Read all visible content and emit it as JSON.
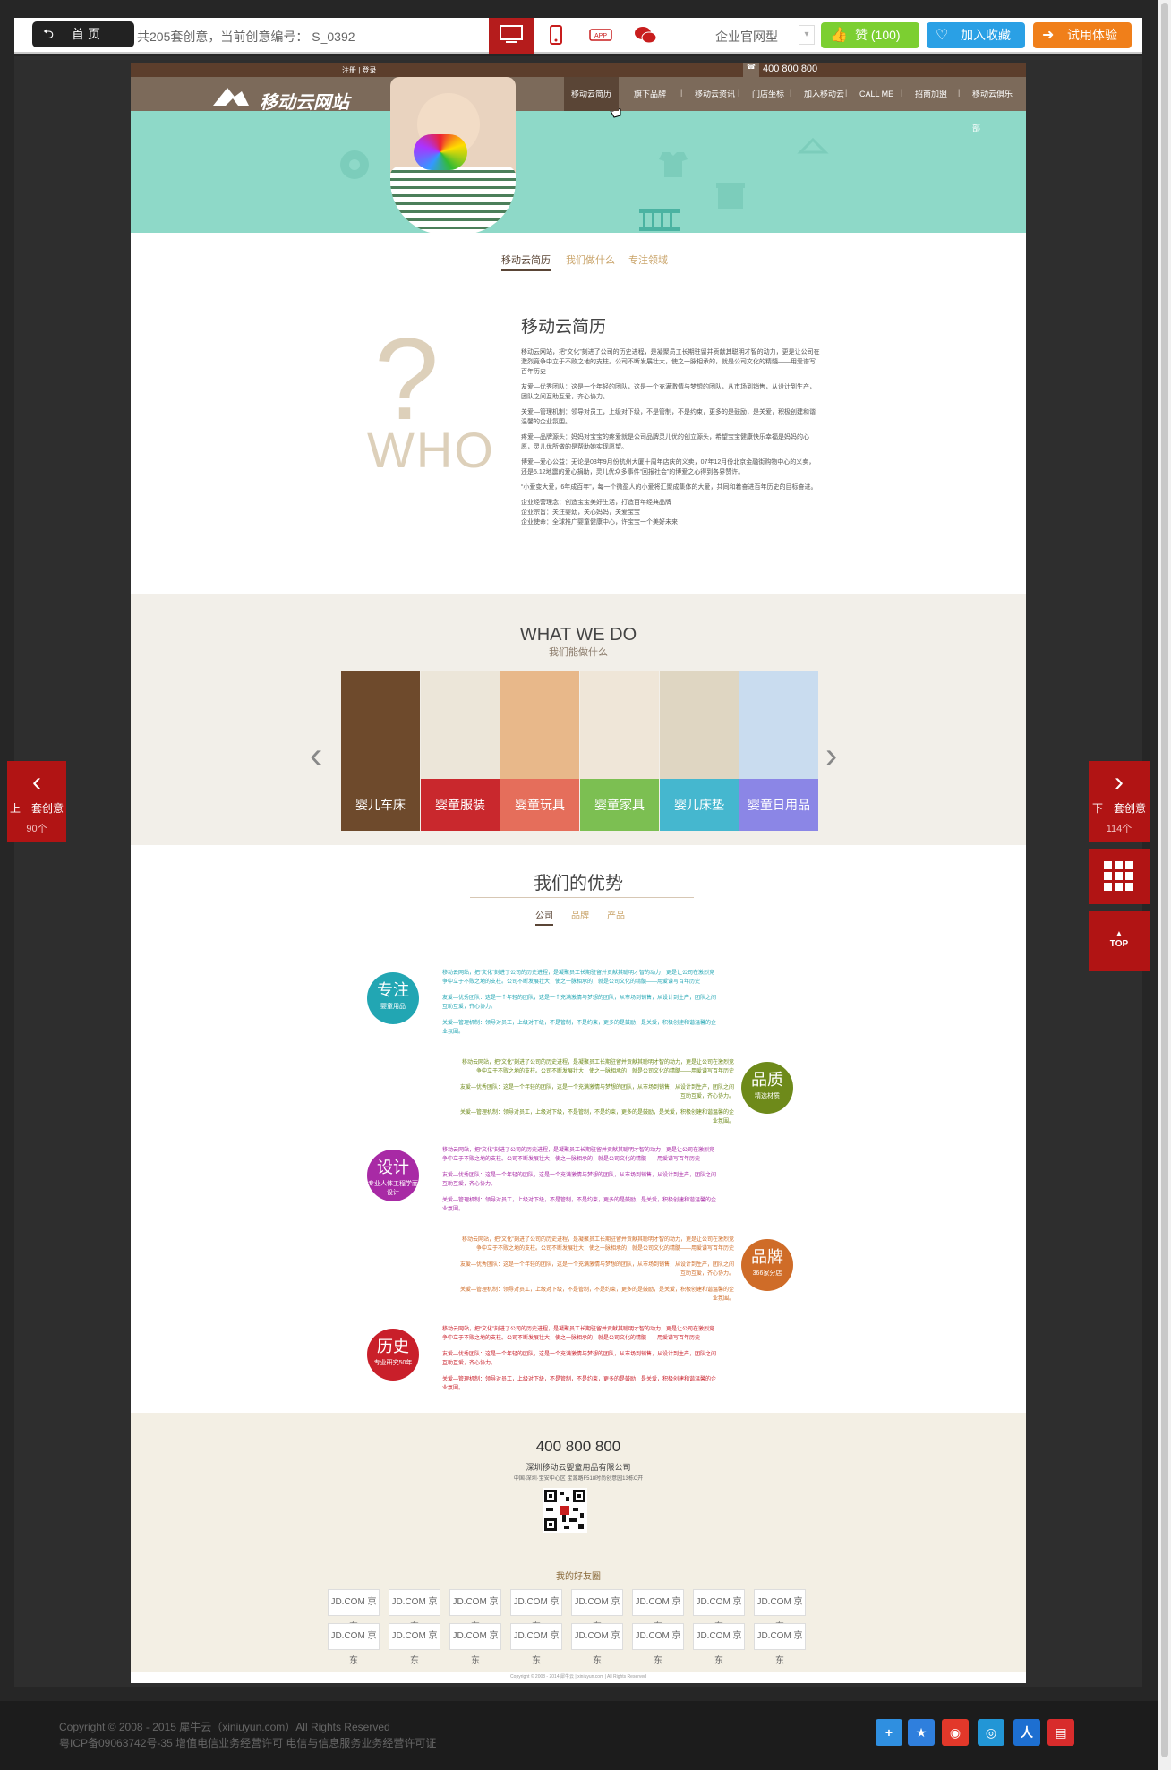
{
  "topbar": {
    "home_label": "首页",
    "count_text": "共205套创意，当前创意编号： S_0392",
    "devices": [
      "desktop-icon",
      "mobile-icon",
      "app-icon",
      "wechat-icon"
    ],
    "site_type": "企业官网型",
    "like_label": "赞 (100)",
    "fav_label": "加入收藏",
    "trial_label": "试用体验",
    "colors": {
      "like": "#7ccf31",
      "fav": "#2aa0e5",
      "trial": "#f07f1a",
      "active": "#b51c1c"
    }
  },
  "site": {
    "strip_left": "注册 | 登录",
    "phone": "400 800 800",
    "logo_text": "移动云网站",
    "nav": [
      "移动云简历",
      "旗下品牌",
      "移动云资讯",
      "门店坐标",
      "加入移动云",
      "CALL ME",
      "招商加盟",
      "移动云俱乐部"
    ],
    "subtabs": [
      "移动云简历",
      "我们做什么",
      "专注领域"
    ],
    "who": {
      "title": "移动云简历",
      "q": "?",
      "word": "WHO",
      "paras": [
        "移动云网站，把“文化”刻进了公司的历史进程，是凝聚员工长期驻留并贡献其聪明才智的动力，更是让公司在激烈竞争中立于不败之地的支柱。公司不断发展壮大，使之一脉相承的，就是公司文化的精髓——用爱谱写百年历史",
        "友爱—优秀团队：这是一个年轻的团队，这是一个充满激情与梦想的团队，从市场到销售，从设计到生产，团队之间互助互爱，齐心协力。",
        "关爱—管理机制：领导对员工，上级对下级，不是管制，不是约束，更多的是鼓励，是关爱，积极创建和谐温馨的企业氛围。",
        "疼爱—品牌源头：妈妈对宝宝的疼爱就是公司品牌灵儿优的创立源头，希望宝宝健康快乐幸福是妈妈的心愿，灵儿优所做的是帮助她实现愿望。",
        "博爱—爱心公益：无论是03年9月份杭州大厦十周年店庆的义卖，07年12月份北京金融街购物中心的义卖，还是5.12地震的爱心捐助，灵儿优众多事件“回报社会”的博爱之心得到各界赞许。",
        "“小爱变大爱，6年成百年”，每一个微盈人的小爱将汇聚成集体的大爱，共同和着奋进百年历史的目标奋进。",
        "企业经营理念：创造宝宝美好生活，打造百年经典品牌\n企业宗旨：关注婴幼，关心妈妈，关爱宝宝\n企业使命：全球推广婴童健康中心，许宝宝一个美好未来"
      ]
    },
    "what": {
      "title": "WHAT WE DO",
      "subtitle": "我们能做什么",
      "cats": [
        {
          "label": "婴儿车床",
          "color": "#5c3b23",
          "img": "#6e4a2c"
        },
        {
          "label": "婴童服装",
          "color": "#c9282d",
          "img": "#ece6d9"
        },
        {
          "label": "婴童玩具",
          "color": "#e56e5b",
          "img": "#e8b88a"
        },
        {
          "label": "婴童家具",
          "color": "#7cbf52",
          "img": "#efe6d8"
        },
        {
          "label": "婴儿床垫",
          "color": "#45b7cf",
          "img": "#dfd6c2"
        },
        {
          "label": "婴童日用品",
          "color": "#8b86e6",
          "img": "#c9dcef"
        }
      ]
    },
    "advantage": {
      "title": "我们的优势",
      "tabs": [
        "公司",
        "品牌",
        "产品"
      ],
      "rows": [
        {
          "big": "专注",
          "small": "婴童用品",
          "color": "#22a6b3",
          "lines": [
            "移动云网站，把“文化”刻进了公司的历史进程，是凝聚员工长期驻留并贡献其聪明才智的动力，更是让公司在激烈竞争中立于不败之地的支柱。公司不断发展壮大，使之一脉相承的，就是公司文化的精髓——用爱谱写百年历史",
            "友爱—优秀团队：这是一个年轻的团队，这是一个充满激情与梦想的团队，从市场到销售，从设计到生产，团队之间互助互爱，齐心协力。",
            "关爱—管理机制：领导对员工，上级对下级，不是管制，不是约束，更多的是鼓励，是关爱，积极创建和谐温馨的企业氛围。"
          ]
        },
        {
          "big": "品质",
          "small": "精选材质",
          "color": "#6e8a1a",
          "lines": [
            "移动云网站，把“文化”刻进了公司的历史进程，是凝聚员工长期驻留并贡献其聪明才智的动力，更是让公司在激烈竞争中立于不败之地的支柱。公司不断发展壮大，使之一脉相承的，就是公司文化的精髓——用爱谱写百年历史",
            "友爱—优秀团队：这是一个年轻的团队，这是一个充满激情与梦想的团队，从市场到销售，从设计到生产，团队之间互助互爱，齐心协力。",
            "关爱—管理机制：领导对员工，上级对下级，不是管制，不是约束，更多的是鼓励，是关爱，积极创建和谐温馨的企业氛围。"
          ]
        },
        {
          "big": "设计",
          "small": "专业人体工程学而设计",
          "color": "#a82aa5",
          "lines": [
            "移动云网站，把“文化”刻进了公司的历史进程，是凝聚员工长期驻留并贡献其聪明才智的动力，更是让公司在激烈竞争中立于不败之地的支柱。公司不断发展壮大，使之一脉相承的，就是公司文化的精髓——用爱谱写百年历史",
            "友爱—优秀团队：这是一个年轻的团队，这是一个充满激情与梦想的团队，从市场到销售，从设计到生产，团队之间互助互爱，齐心协力。",
            "关爱—管理机制：领导对员工，上级对下级，不是管制，不是约束，更多的是鼓励，是关爱，积极创建和谐温馨的企业氛围。"
          ]
        },
        {
          "big": "品牌",
          "small": "366家分店",
          "color": "#cf6c28",
          "lines": [
            "移动云网站，把“文化”刻进了公司的历史进程，是凝聚员工长期驻留并贡献其聪明才智的动力，更是让公司在激烈竞争中立于不败之地的支柱。公司不断发展壮大，使之一脉相承的，就是公司文化的精髓——用爱谱写百年历史",
            "友爱—优秀团队：这是一个年轻的团队，这是一个充满激情与梦想的团队，从市场到销售，从设计到生产，团队之间互助互爱，齐心协力。",
            "关爱—管理机制：领导对员工，上级对下级，不是管制，不是约束，更多的是鼓励，是关爱，积极创建和谐温馨的企业氛围。"
          ]
        },
        {
          "big": "历史",
          "small": "专业研究50年",
          "color": "#c91f2a",
          "lines": [
            "移动云网站，把“文化”刻进了公司的历史进程，是凝聚员工长期驻留并贡献其聪明才智的动力，更是让公司在激烈竞争中立于不败之地的支柱。公司不断发展壮大，使之一脉相承的，就是公司文化的精髓——用爱谱写百年历史",
            "友爱—优秀团队：这是一个年轻的团队，这是一个充满激情与梦想的团队，从市场到销售，从设计到生产，团队之间互助互爱，齐心协力。",
            "关爱—管理机制：领导对员工，上级对下级，不是管制，不是约束，更多的是鼓励，是关爱，积极创建和谐温馨的企业氛围。"
          ]
        }
      ]
    },
    "footer": {
      "phone": "400 800 800",
      "company": "深圳移动云婴童用品有限公司",
      "address": "中国·深圳·宝安中心区 宝源路F518时尚创意园13栋C开",
      "friends_title": "我的好友圈",
      "friend_logo": "JD.COM 京东",
      "copyright": "Copyright © 2008 - 2014 犀牛云 | xiniuyun.com | All Rights Reserved"
    }
  },
  "side": {
    "prev_label": "上一套创意",
    "prev_count": "90个",
    "next_label": "下一套创意",
    "next_count": "114个",
    "top_label": "TOP"
  },
  "bottom": {
    "copyright": "Copyright © 2008 - 2015 犀牛云（xiniuyun.com）All Rights Reserved",
    "icp": "粤ICP备09063742号-35 增值电信业务经营许可 电信与信息服务业务经营许可证",
    "socials": [
      {
        "name": "share-plus-icon",
        "color": "#2f8fe0"
      },
      {
        "name": "qzone-icon",
        "color": "#2f7fdd"
      },
      {
        "name": "weibo-icon",
        "color": "#e2382a"
      },
      {
        "name": "tencent-weibo-icon",
        "color": "#2296d6"
      },
      {
        "name": "renren-icon",
        "color": "#1d6fd1"
      },
      {
        "name": "douban-icon",
        "color": "#d82c2c"
      }
    ]
  }
}
